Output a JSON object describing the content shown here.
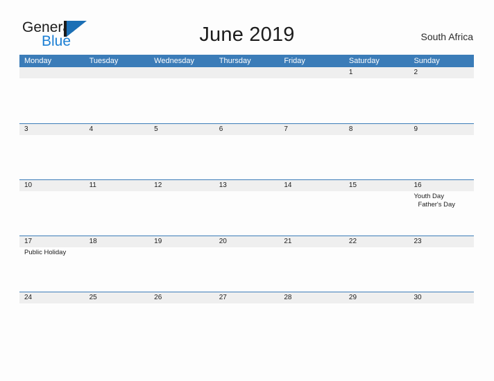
{
  "branding": {
    "logo_text_1": "General",
    "logo_text_2": "Blue",
    "logo_mark_icon": "triangle-flag-icon"
  },
  "header": {
    "title": "June 2019",
    "country": "South Africa"
  },
  "colors": {
    "header_blue": "#3b7cb8",
    "row_band_gray": "#efefef",
    "logo_blue": "#1b7fd4",
    "page_background": "#fdfdfd",
    "text_dark": "#1c1c1c"
  },
  "calendar": {
    "weekday_headers": [
      "Monday",
      "Tuesday",
      "Wednesday",
      "Thursday",
      "Friday",
      "Saturday",
      "Sunday"
    ],
    "weeks": [
      {
        "days": [
          {
            "num": "",
            "events": []
          },
          {
            "num": "",
            "events": []
          },
          {
            "num": "",
            "events": []
          },
          {
            "num": "",
            "events": []
          },
          {
            "num": "",
            "events": []
          },
          {
            "num": "1",
            "events": []
          },
          {
            "num": "2",
            "events": []
          }
        ]
      },
      {
        "days": [
          {
            "num": "3",
            "events": []
          },
          {
            "num": "4",
            "events": []
          },
          {
            "num": "5",
            "events": []
          },
          {
            "num": "6",
            "events": []
          },
          {
            "num": "7",
            "events": []
          },
          {
            "num": "8",
            "events": []
          },
          {
            "num": "9",
            "events": []
          }
        ]
      },
      {
        "days": [
          {
            "num": "10",
            "events": []
          },
          {
            "num": "11",
            "events": []
          },
          {
            "num": "12",
            "events": []
          },
          {
            "num": "13",
            "events": []
          },
          {
            "num": "14",
            "events": []
          },
          {
            "num": "15",
            "events": []
          },
          {
            "num": "16",
            "events": [
              {
                "label": "Youth Day",
                "indent": false
              },
              {
                "label": "Father's Day",
                "indent": true
              }
            ]
          }
        ]
      },
      {
        "days": [
          {
            "num": "17",
            "events": [
              {
                "label": "Public Holiday",
                "indent": false
              }
            ]
          },
          {
            "num": "18",
            "events": []
          },
          {
            "num": "19",
            "events": []
          },
          {
            "num": "20",
            "events": []
          },
          {
            "num": "21",
            "events": []
          },
          {
            "num": "22",
            "events": []
          },
          {
            "num": "23",
            "events": []
          }
        ]
      },
      {
        "days": [
          {
            "num": "24",
            "events": []
          },
          {
            "num": "25",
            "events": []
          },
          {
            "num": "26",
            "events": []
          },
          {
            "num": "27",
            "events": []
          },
          {
            "num": "28",
            "events": []
          },
          {
            "num": "29",
            "events": []
          },
          {
            "num": "30",
            "events": []
          }
        ]
      }
    ]
  }
}
